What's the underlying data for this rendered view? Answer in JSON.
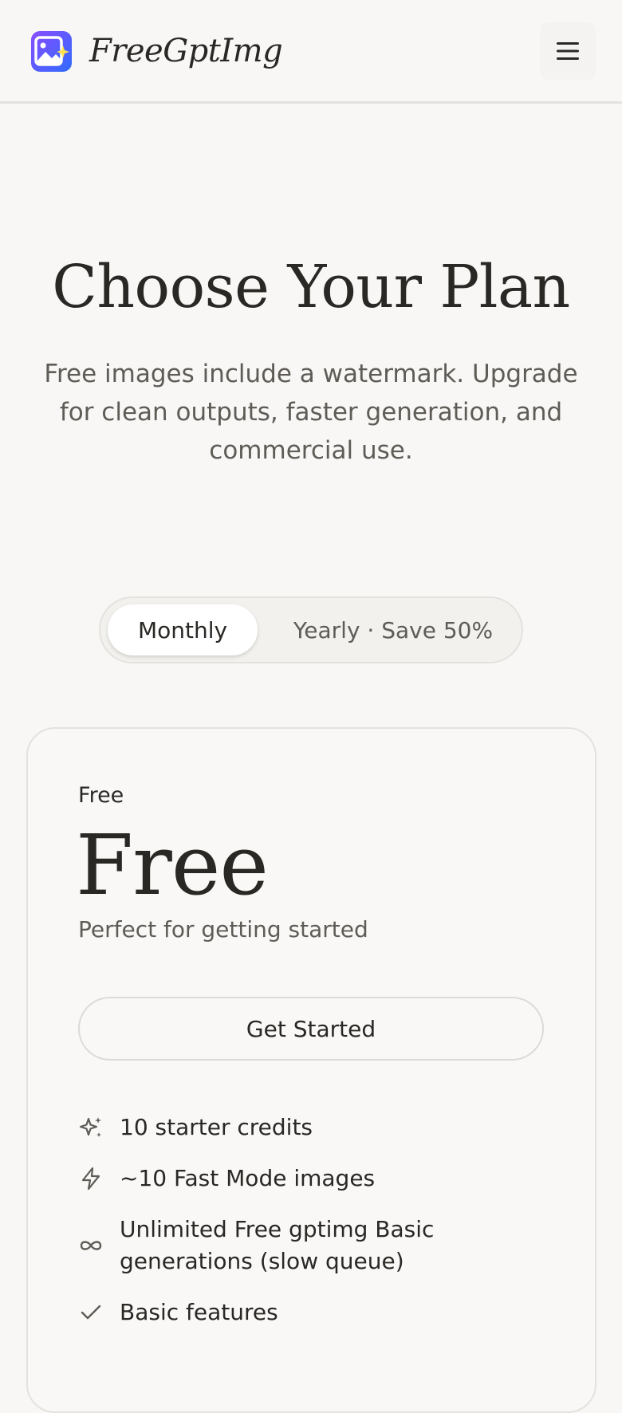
{
  "header": {
    "brand": "FreeGptImg",
    "logo_icon": "image-sparkle-icon",
    "menu_icon": "hamburger-menu-icon",
    "logo_gradient": [
      "#7b4dff",
      "#3d6cff"
    ]
  },
  "hero": {
    "title": "Choose Your Plan",
    "subtitle": "Free images include a watermark. Upgrade for clean outputs, faster generation, and commercial use."
  },
  "billing_toggle": {
    "options": [
      {
        "label": "Monthly",
        "selected": true
      },
      {
        "label": "Yearly · Save 50%",
        "selected": false
      }
    ]
  },
  "plan": {
    "label": "Free",
    "price": "Free",
    "description": "Perfect for getting started",
    "cta_label": "Get Started",
    "features": [
      {
        "icon": "sparkles-icon",
        "text": "10 starter credits"
      },
      {
        "icon": "lightning-icon",
        "text": "~10 Fast Mode images"
      },
      {
        "icon": "infinity-icon",
        "text": "Unlimited Free gptimg Basic generations (slow queue)"
      },
      {
        "icon": "check-icon",
        "text": "Basic features"
      }
    ]
  },
  "colors": {
    "background": "#f8f7f5",
    "text": "#2a2825",
    "muted_text": "#5f5c57",
    "border": "#e4e2de"
  }
}
